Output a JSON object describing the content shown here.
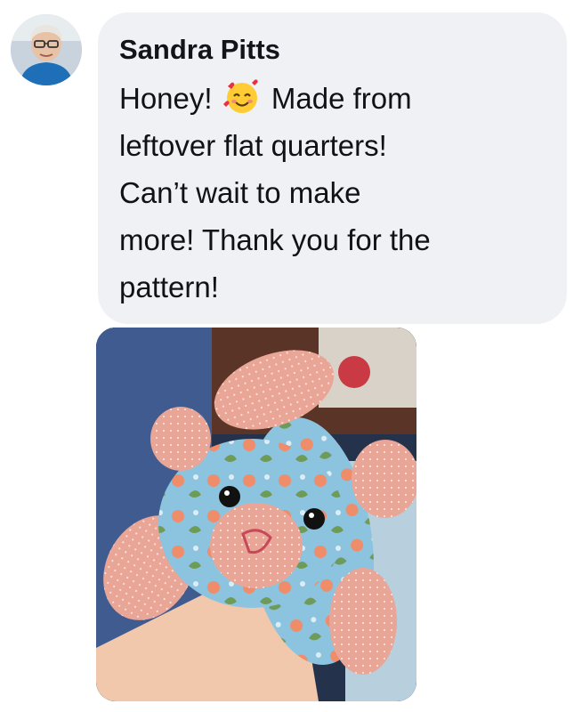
{
  "comment": {
    "author": "Sandra Pitts",
    "message_part1": "Honey!",
    "emoji": "smiling-face-with-hearts",
    "message_part2": "Made from\nleftover flat quarters!\nCan’t wait to make\nmore! Thank you for the\npattern!"
  },
  "colors": {
    "bubble": "#eff1f5",
    "text": "#101216"
  }
}
